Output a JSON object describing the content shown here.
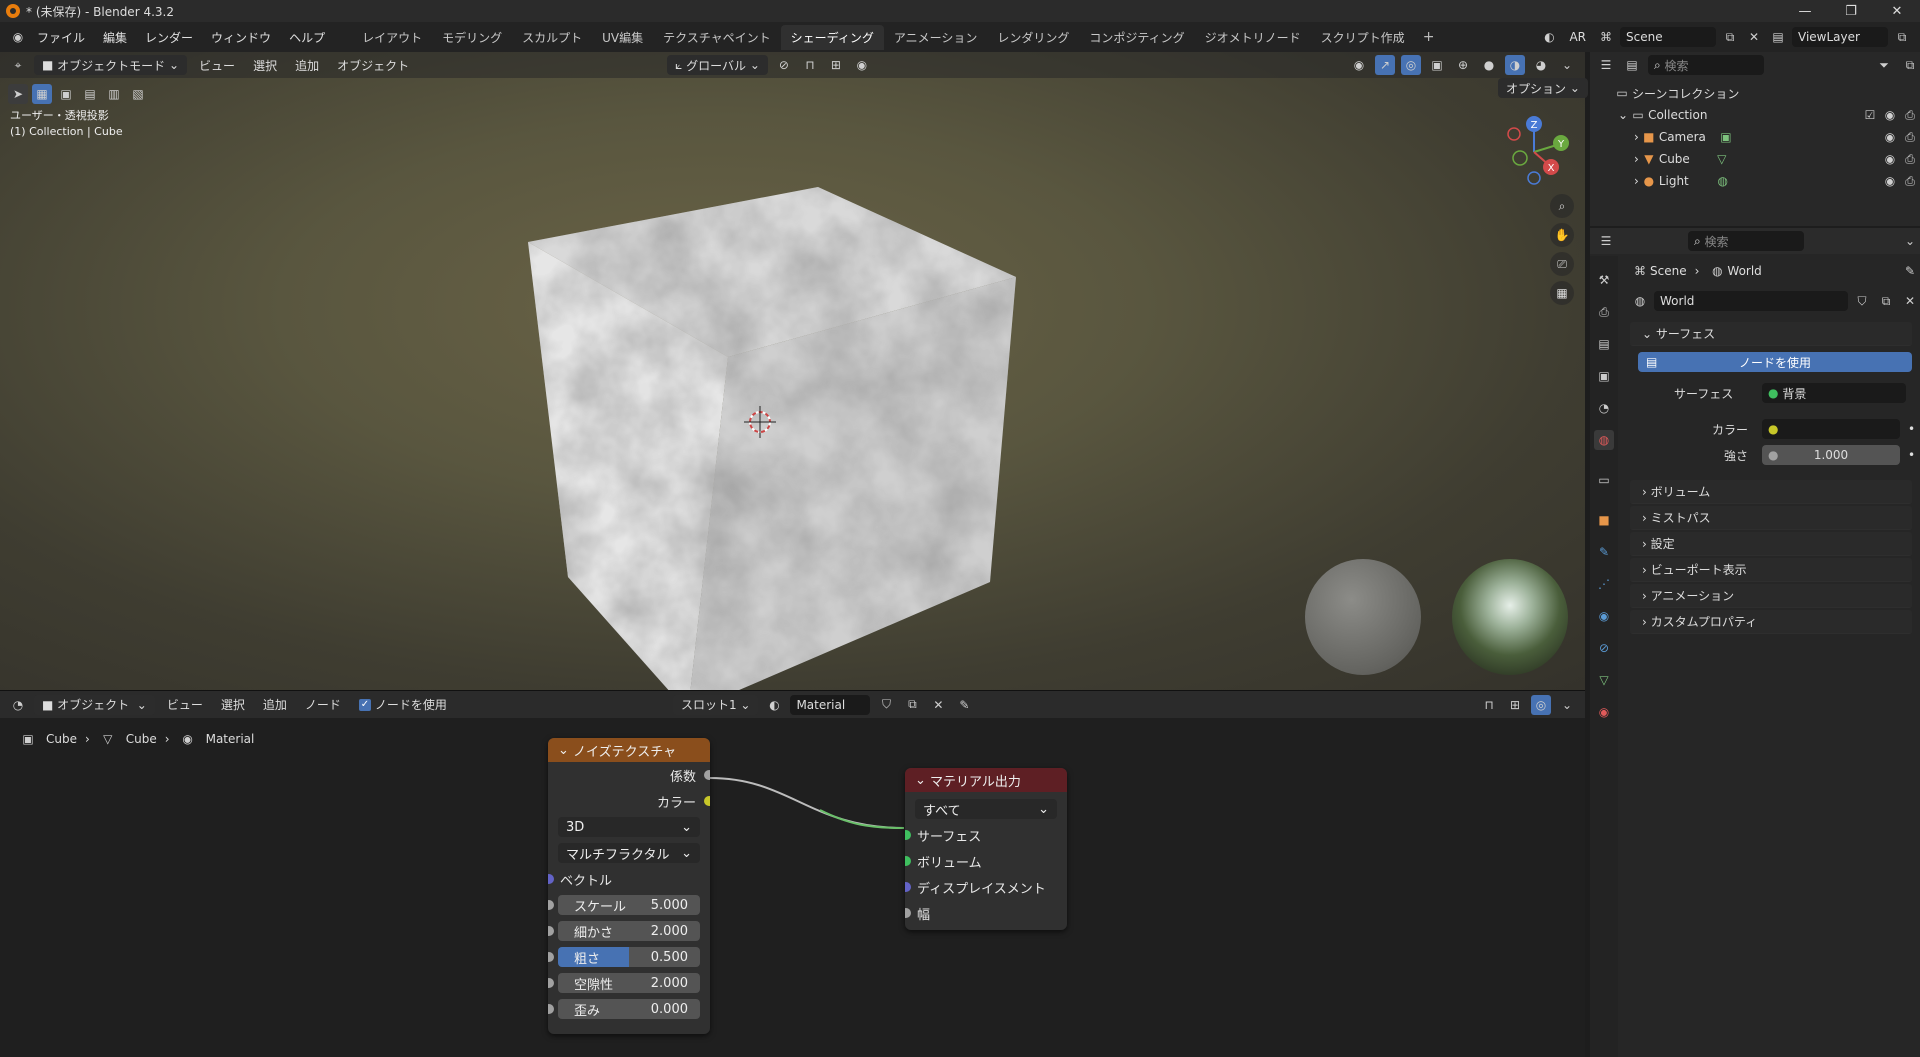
{
  "window": {
    "title": "* (未保存) - Blender 4.3.2",
    "controls": [
      "—",
      "❐",
      "✕"
    ]
  },
  "menu": {
    "items": [
      "ファイル",
      "編集",
      "レンダー",
      "ウィンドウ",
      "ヘルプ"
    ]
  },
  "workspaces": {
    "tabs": [
      "レイアウト",
      "モデリング",
      "スカルプト",
      "UV編集",
      "テクスチャペイント",
      "シェーディング",
      "アニメーション",
      "レンダリング",
      "コンポジティング",
      "ジオメトリノード",
      "スクリプト作成"
    ],
    "active": "シェーディング"
  },
  "topright": {
    "engine": "AR",
    "scene": "Scene",
    "view_layer": "ViewLayer"
  },
  "viewport": {
    "mode": "オブジェクトモード",
    "menus": [
      "ビュー",
      "選択",
      "追加",
      "オブジェクト"
    ],
    "orientation": "グローバル",
    "options": "オプション",
    "view_label": "ユーザー・透視投影",
    "collection_label": "(1) Collection | Cube",
    "gizmo": {
      "z": "Z",
      "y": "Y",
      "x": "X"
    }
  },
  "node_editor": {
    "type": "オブジェクト",
    "menus": [
      "ビュー",
      "選択",
      "追加",
      "ノード"
    ],
    "use_nodes_label": "ノードを使用",
    "slot": "スロット1",
    "material": "Material",
    "breadcrumb": [
      "Cube",
      "Cube",
      "Material"
    ],
    "noise": {
      "title": "ノイズテクスチャ",
      "out_fac": "係数",
      "out_color": "カラー",
      "dim": "3D",
      "type": "マルチフラクタル",
      "vector": "ベクトル",
      "fields": [
        {
          "label": "スケール",
          "value": "5.000"
        },
        {
          "label": "細かさ",
          "value": "2.000"
        },
        {
          "label": "粗さ",
          "value": "0.500"
        },
        {
          "label": "空隙性",
          "value": "2.000"
        },
        {
          "label": "歪み",
          "value": "0.000"
        }
      ]
    },
    "output": {
      "title": "マテリアル出力",
      "target": "すべて",
      "inputs": [
        "サーフェス",
        "ボリューム",
        "ディスプレイスメント",
        "幅"
      ]
    }
  },
  "outliner": {
    "search_placeholder": "検索",
    "root": "シーンコレクション",
    "collection": "Collection",
    "items": [
      "Camera",
      "Cube",
      "Light"
    ]
  },
  "properties": {
    "search_placeholder": "検索",
    "crumb_scene": "Scene",
    "crumb_world": "World",
    "world_name": "World",
    "surface_panel": "サーフェス",
    "use_nodes": "ノードを使用",
    "surface_label": "サーフェス",
    "surface_value": "背景",
    "color_label": "カラー",
    "strength_label": "強さ",
    "strength_value": "1.000",
    "panels": [
      "ボリューム",
      "ミストパス",
      "設定",
      "ビューポート表示",
      "アニメーション",
      "カスタムプロパティ"
    ]
  }
}
